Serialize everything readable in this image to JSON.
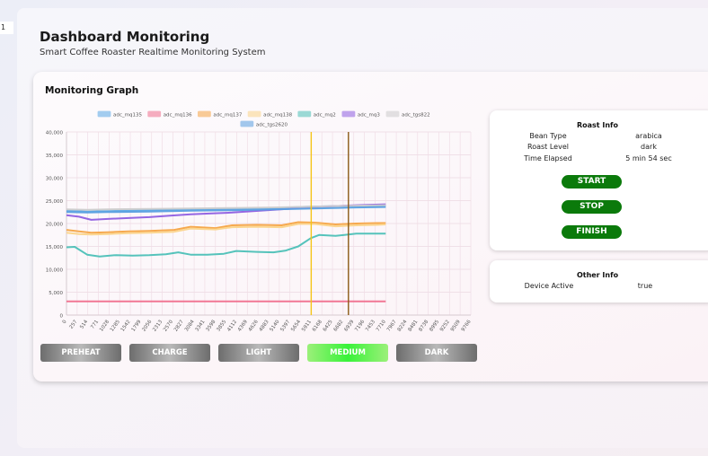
{
  "sidebar": {
    "tab_label": "1"
  },
  "header": {
    "title": "Dashboard Monitoring",
    "subtitle": "Smart Coffee Roaster Realtime Monitoring System"
  },
  "graph": {
    "title": "Monitoring Graph"
  },
  "chart_data": {
    "type": "line",
    "title": "",
    "xlabel": "",
    "ylabel": "",
    "ylim": [
      0,
      40000
    ],
    "yticks": [
      0,
      5000,
      10000,
      15000,
      20000,
      25000,
      30000,
      35000,
      40000
    ],
    "ytick_labels": [
      "0",
      "5,000",
      "10,000",
      "15,000",
      "20,000",
      "25,000",
      "30,000",
      "35,000",
      "40,000"
    ],
    "xticks": [
      0,
      257,
      514,
      771,
      1028,
      1285,
      1542,
      1799,
      2056,
      2313,
      2570,
      2827,
      3084,
      3341,
      3598,
      3855,
      4112,
      4369,
      4626,
      4883,
      5140,
      5397,
      5654,
      5911,
      6168,
      6425,
      6682,
      6939,
      7196,
      7453,
      7710,
      7967,
      8224,
      8481,
      8738,
      8995,
      9252,
      9509,
      9766
    ],
    "xlim": [
      0,
      9766
    ],
    "grid": true,
    "legend_position": "top",
    "markers": [
      {
        "x": 5911,
        "color": "#f5c518"
      },
      {
        "x": 6810,
        "color": "#8b5a16"
      }
    ],
    "series": [
      {
        "name": "adc_mq135",
        "color": "#5aa7e6",
        "x": [
          0,
          500,
          1000,
          2000,
          3000,
          4000,
          5000,
          5600,
          6000,
          6500,
          7000,
          7500,
          7710
        ],
        "values": [
          22800,
          22600,
          22700,
          22900,
          23100,
          23200,
          23300,
          23600,
          23700,
          23800,
          23800,
          23800,
          23900
        ]
      },
      {
        "name": "adc_mq136",
        "color": "#f0708e",
        "x": [
          0,
          1000,
          2000,
          3000,
          4000,
          5000,
          6000,
          7000,
          7710
        ],
        "values": [
          3000,
          3000,
          3000,
          3000,
          3000,
          3000,
          3000,
          3000,
          3000
        ]
      },
      {
        "name": "adc_mq137",
        "color": "#f5a445",
        "x": [
          0,
          300,
          600,
          1000,
          1500,
          2000,
          2600,
          3000,
          3600,
          4000,
          4600,
          5200,
          5600,
          6000,
          6500,
          7000,
          7500,
          7710
        ],
        "values": [
          18600,
          18300,
          18000,
          18100,
          18300,
          18400,
          18600,
          19300,
          19000,
          19600,
          19700,
          19600,
          20300,
          20200,
          19800,
          20000,
          20100,
          20100
        ]
      },
      {
        "name": "adc_mq138",
        "color": "#fbd48a",
        "x": [
          0,
          300,
          600,
          1000,
          1500,
          2000,
          2600,
          3000,
          3600,
          4000,
          4600,
          5200,
          5600,
          6000,
          6500,
          7000,
          7500,
          7710
        ],
        "values": [
          18000,
          17700,
          17600,
          17700,
          17900,
          18000,
          18200,
          18900,
          18700,
          19200,
          19300,
          19200,
          19900,
          19900,
          19400,
          19600,
          19700,
          19800
        ]
      },
      {
        "name": "adc_mq2",
        "color": "#4cc0b7",
        "x": [
          0,
          200,
          500,
          800,
          1200,
          1600,
          2000,
          2400,
          2700,
          3000,
          3400,
          3800,
          4100,
          4600,
          5000,
          5300,
          5600,
          5900,
          6100,
          6500,
          7000,
          7500,
          7710
        ],
        "values": [
          14800,
          14900,
          13200,
          12800,
          13100,
          13000,
          13100,
          13300,
          13700,
          13200,
          13200,
          13400,
          14000,
          13800,
          13700,
          14100,
          15000,
          16800,
          17500,
          17300,
          17800,
          17800,
          17800
        ]
      },
      {
        "name": "adc_mq3",
        "color": "#8f5ee0",
        "x": [
          0,
          300,
          600,
          1000,
          1500,
          2000,
          2500,
          3000,
          3500,
          4000,
          4500,
          5000,
          5500,
          6000,
          6500,
          7000,
          7710
        ],
        "values": [
          21800,
          21500,
          20800,
          21000,
          21200,
          21400,
          21700,
          22000,
          22200,
          22400,
          22700,
          23000,
          23300,
          23600,
          23800,
          24000,
          24200
        ]
      },
      {
        "name": "adc_tgs822",
        "color": "#cccccc",
        "x": [
          0,
          500,
          1000,
          2000,
          3000,
          4000,
          5000,
          6000,
          7000,
          7710
        ],
        "values": [
          23100,
          23000,
          23100,
          23200,
          23300,
          23400,
          23500,
          23700,
          23900,
          24000
        ]
      },
      {
        "name": "adc_tgs2620",
        "color": "#5aa0e0",
        "x": [
          0,
          500,
          1000,
          2000,
          3000,
          4000,
          5000,
          6000,
          7000,
          7710
        ],
        "values": [
          22500,
          22400,
          22500,
          22600,
          22800,
          22900,
          23100,
          23300,
          23500,
          23600
        ]
      }
    ]
  },
  "roast_info": {
    "title": "Roast Info",
    "rows": [
      {
        "label": "Bean Type",
        "value": "arabica"
      },
      {
        "label": "Roast Level",
        "value": "dark"
      },
      {
        "label": "Time Elapsed",
        "value": "5 min 54 sec"
      }
    ],
    "buttons": {
      "start": "START",
      "stop": "STOP",
      "finish": "FINISH"
    },
    "button_color": "#0b7a0b"
  },
  "other_info": {
    "title": "Other Info",
    "rows": [
      {
        "label": "Device Active",
        "value": "true"
      }
    ]
  },
  "phases": {
    "buttons": [
      "PREHEAT",
      "CHARGE",
      "LIGHT",
      "MEDIUM",
      "DARK"
    ],
    "active": "MEDIUM",
    "active_color": "#39f23a"
  }
}
